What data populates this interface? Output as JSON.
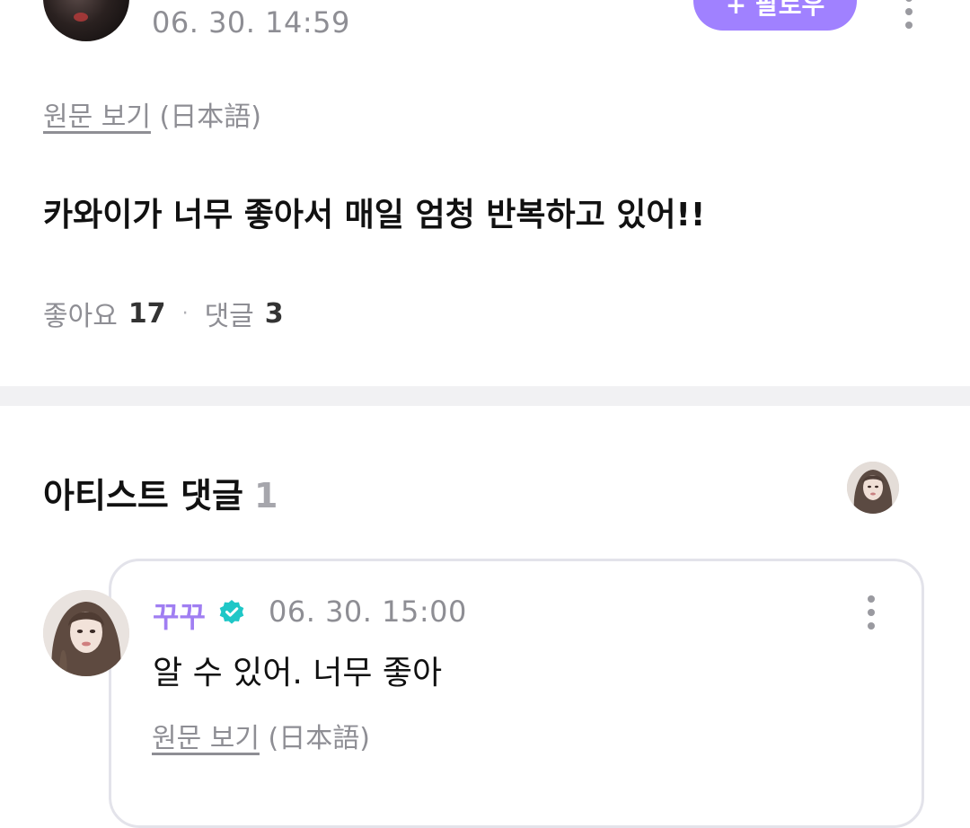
{
  "post": {
    "timestamp": "06. 30. 14:59",
    "follow_label": "+ 팔로우",
    "original_link": "원문 보기",
    "original_lang": "(日本語)",
    "body": "카와이가 너무 좋아서 매일 엄청 반복하고 있어!!",
    "likes_label": "좋아요",
    "likes_count": "17",
    "separator": "·",
    "comments_label": "댓글",
    "comments_count": "3"
  },
  "artist_comments": {
    "title": "아티스트 댓글",
    "count": "1",
    "items": [
      {
        "author": "꾸꾸",
        "verified": true,
        "timestamp": "06. 30. 15:00",
        "body": "알 수 있어. 너무 좋아",
        "original_link": "원문 보기",
        "original_lang": "(日本語)"
      }
    ]
  },
  "colors": {
    "accent": "#a081ff",
    "author_name": "#a07ef2",
    "verified_badge": "#1fc7c7",
    "muted_text": "#8e8e94",
    "divider": "#f1f1f3"
  },
  "icons": {
    "more": "more-vertical-icon",
    "verified": "verified-badge-icon"
  }
}
